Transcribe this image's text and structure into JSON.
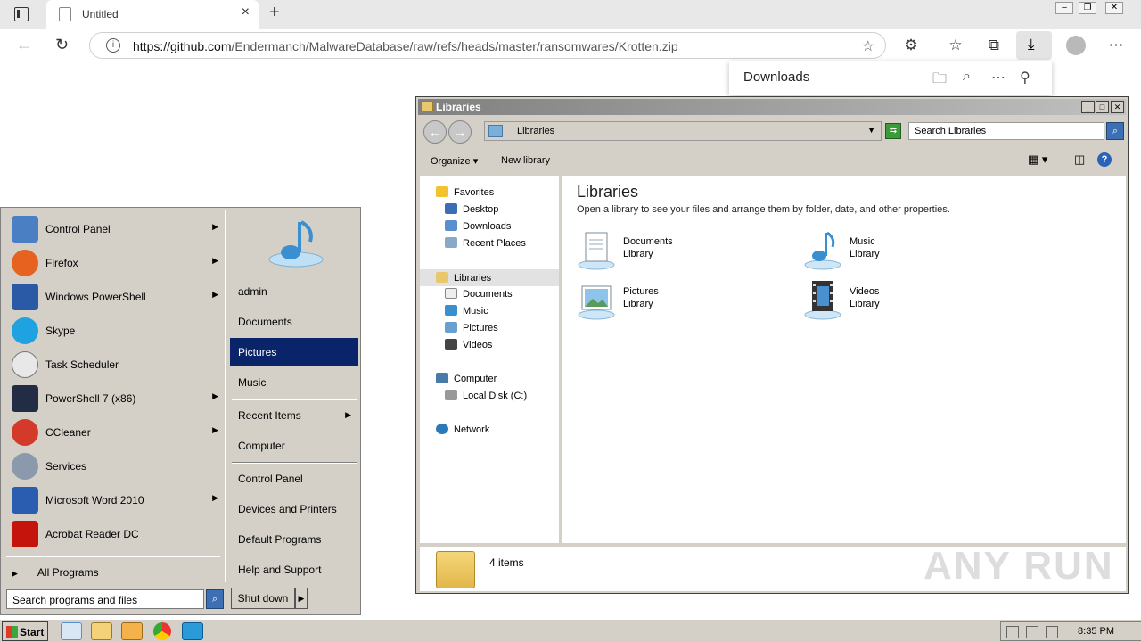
{
  "browser": {
    "tab_title": "Untitled",
    "url_domain": "https://github.com",
    "url_path": "/Endermanch/MalwareDatabase/raw/refs/heads/master/ransomwares/Krotten.zip",
    "downloads_title": "Downloads"
  },
  "start_menu": {
    "programs": [
      {
        "label": "Control Panel",
        "has_arrow": true,
        "color": "#4a7fc4"
      },
      {
        "label": "Firefox",
        "has_arrow": true,
        "color": "#e8621f"
      },
      {
        "label": "Windows PowerShell",
        "has_arrow": true,
        "color": "#2a5aa6"
      },
      {
        "label": "Skype",
        "has_arrow": false,
        "color": "#1fa2e0"
      },
      {
        "label": "Task Scheduler",
        "has_arrow": false,
        "color": "#cfcfcf"
      },
      {
        "label": "PowerShell 7 (x86)",
        "has_arrow": true,
        "color": "#222c44"
      },
      {
        "label": "CCleaner",
        "has_arrow": true,
        "color": "#d33a2a"
      },
      {
        "label": "Services",
        "has_arrow": false,
        "color": "#8a9aac"
      },
      {
        "label": "Microsoft Word 2010",
        "has_arrow": true,
        "color": "#2a5db0"
      },
      {
        "label": "Acrobat Reader DC",
        "has_arrow": false,
        "color": "#c4140c"
      }
    ],
    "all_programs": "All Programs",
    "search_placeholder": "Search programs and files",
    "right_items": {
      "admin": "admin",
      "documents": "Documents",
      "pictures": "Pictures",
      "music": "Music",
      "recent_items": "Recent Items",
      "computer": "Computer",
      "control_panel": "Control Panel",
      "devices_printers": "Devices and Printers",
      "default_programs": "Default Programs",
      "help_support": "Help and Support"
    },
    "shutdown_label": "Shut down"
  },
  "explorer": {
    "title": "Libraries",
    "address": "Libraries",
    "search_placeholder": "Search Libraries",
    "commands": {
      "organize": "Organize",
      "new_library": "New library"
    },
    "nav": {
      "favorites": "Favorites",
      "desktop": "Desktop",
      "downloads": "Downloads",
      "recent_places": "Recent Places",
      "libraries": "Libraries",
      "documents": "Documents",
      "music": "Music",
      "pictures": "Pictures",
      "videos": "Videos",
      "computer": "Computer",
      "local_disk": "Local Disk (C:)",
      "network": "Network"
    },
    "heading": "Libraries",
    "subheading": "Open a library to see your files and arrange them by folder, date, and other properties.",
    "libraries": [
      {
        "name": "Documents",
        "kind": "Library"
      },
      {
        "name": "Music",
        "kind": "Library"
      },
      {
        "name": "Pictures",
        "kind": "Library"
      },
      {
        "name": "Videos",
        "kind": "Library"
      }
    ],
    "status": "4 items"
  },
  "taskbar": {
    "start_label": "Start",
    "clock": "8:35 PM"
  },
  "watermark": "ANY RUN"
}
